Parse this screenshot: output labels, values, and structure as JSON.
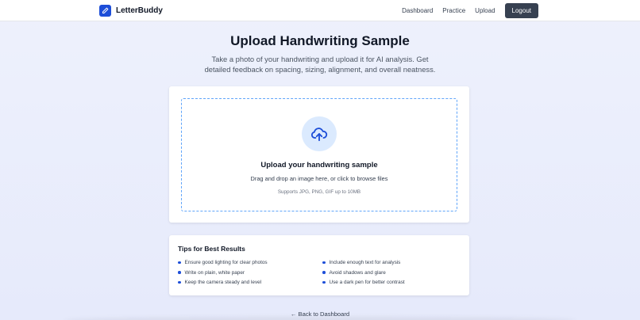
{
  "nav": {
    "brand": "LetterBuddy",
    "links": [
      "Dashboard",
      "Practice",
      "Upload"
    ],
    "logout": "Logout"
  },
  "hero": {
    "title": "Upload Handwriting Sample",
    "subtitle": "Take a photo of your handwriting and upload it for AI analysis. Get detailed feedback on spacing, sizing, alignment, and overall neatness."
  },
  "upload": {
    "icon": "cloud-upload-icon",
    "title": "Upload your handwriting sample",
    "description": "Drag and drop an image here, or click to browse files",
    "supported": "Supports JPG, PNG, GIF up to 10MB"
  },
  "tips": {
    "title": "Tips for Best Results",
    "items": [
      "Ensure good lighting for clear photos",
      "Include enough text for analysis",
      "Write on plain, white paper",
      "Avoid shadows and glare",
      "Keep the camera steady and level",
      "Use a dark pen for better contrast"
    ]
  },
  "back_link": "← Back to Dashboard",
  "colors": {
    "accent": "#1d4ed8",
    "dropzone_border": "#60a5fa",
    "icon_bg": "#dbeafe",
    "logout_bg": "#374151"
  }
}
